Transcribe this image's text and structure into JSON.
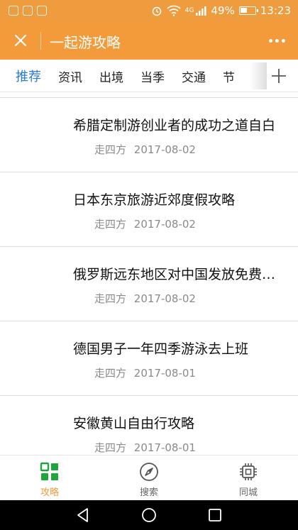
{
  "status_bar": {
    "network": "4G",
    "battery_percent": "49%",
    "time": "13:23"
  },
  "header": {
    "title": "一起游攻略"
  },
  "tabs": [
    {
      "label": "推荐",
      "active": true
    },
    {
      "label": "资讯",
      "active": false
    },
    {
      "label": "出境",
      "active": false
    },
    {
      "label": "当季",
      "active": false
    },
    {
      "label": "交通",
      "active": false
    },
    {
      "label": "节",
      "active": false
    }
  ],
  "articles": [
    {
      "title": "希腊定制游创业者的成功之道自白",
      "author": "走四方",
      "date": "2017-08-02"
    },
    {
      "title": "日本东京旅游近郊度假攻略",
      "author": "走四方",
      "date": "2017-08-02"
    },
    {
      "title": "俄罗斯远东地区对中国发放免费…",
      "author": "走四方",
      "date": "2017-08-02"
    },
    {
      "title": "德国男子一年四季游泳去上班",
      "author": "走四方",
      "date": "2017-08-01"
    },
    {
      "title": "安徽黄山自由行攻略",
      "author": "走四方",
      "date": "2017-08-01"
    }
  ],
  "bottom_nav": [
    {
      "label": "攻略",
      "icon": "grid-icon",
      "active": true
    },
    {
      "label": "搜索",
      "icon": "compass-icon",
      "active": false
    },
    {
      "label": "同城",
      "icon": "chip-icon",
      "active": false
    }
  ],
  "colors": {
    "header_orange": "#f39a3a",
    "active_tab_blue": "#2b7cd3",
    "nav_active_green": "#1fa53c",
    "nav_active_label": "#ee9c3d"
  }
}
